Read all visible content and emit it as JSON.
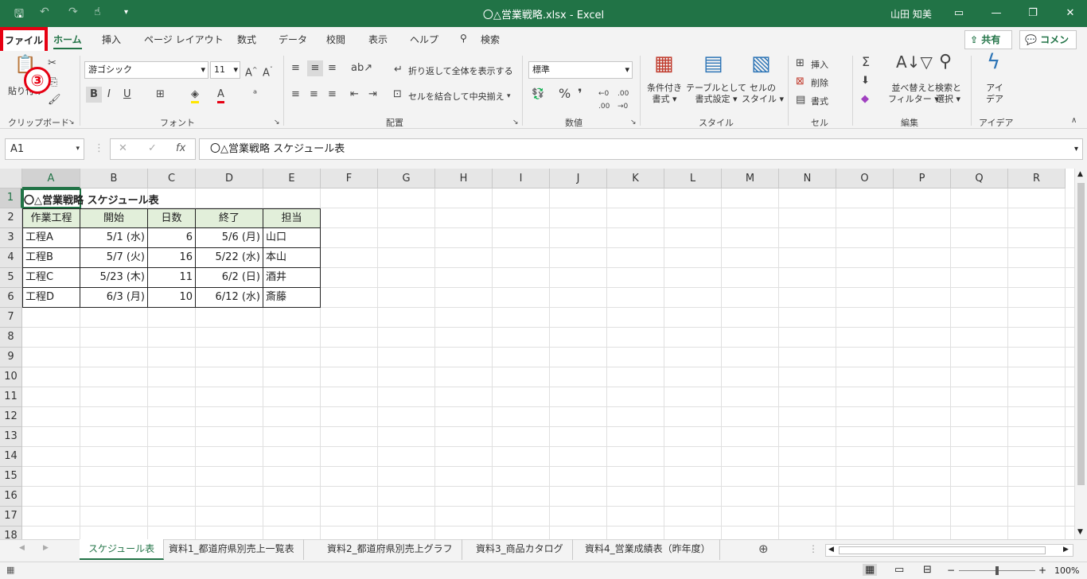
{
  "window": {
    "title": "〇△営業戦略.xlsx  -  Excel",
    "user": "山田 知美"
  },
  "ribbon_tabs": [
    "ファイル",
    "ホーム",
    "挿入",
    "ページ レイアウト",
    "数式",
    "データ",
    "校閲",
    "表示",
    "ヘルプ",
    "検索"
  ],
  "share": "共有",
  "comment": "コメント",
  "step_badge": "③",
  "clipboard": {
    "paste": "貼り付け",
    "group": "クリップボード"
  },
  "font": {
    "name": "游ゴシック",
    "size": "11",
    "bold": "B",
    "italic": "I",
    "underline": "U",
    "group": "フォント"
  },
  "alignment": {
    "wrap": "折り返して全体を表示する",
    "merge": "セルを結合して中央揃え",
    "group": "配置"
  },
  "number": {
    "format": "標準",
    "percent": "%",
    "comma": "❜",
    "group": "数値"
  },
  "styles": {
    "cond": [
      "条件付き",
      "書式"
    ],
    "table": [
      "テーブルとして",
      "書式設定"
    ],
    "cell": [
      "セルの",
      "スタイル"
    ],
    "group": "スタイル"
  },
  "cells": {
    "insert": "挿入",
    "delete": "削除",
    "format": "書式",
    "group": "セル"
  },
  "editing": {
    "sum": "Σ",
    "sort": [
      "並べ替えと",
      "フィルター"
    ],
    "find": [
      "検索と",
      "選択"
    ],
    "group": "編集"
  },
  "ideas": {
    "label": [
      "アイ",
      "デア"
    ],
    "group": "アイデア"
  },
  "name_box": "A1",
  "fx": "fx",
  "formula": "〇△営業戦略 スケジュール表",
  "columns": [
    "A",
    "B",
    "C",
    "D",
    "E",
    "F",
    "G",
    "H",
    "I",
    "J",
    "K",
    "L",
    "M",
    "N",
    "O",
    "P",
    "Q",
    "R"
  ],
  "rows": [
    "1",
    "2",
    "3",
    "4",
    "5",
    "6",
    "7",
    "8",
    "9",
    "10",
    "11",
    "12",
    "13",
    "14",
    "15",
    "16",
    "17",
    "18"
  ],
  "sheet": {
    "title": "〇△営業戦略 スケジュール表",
    "headers": [
      "作業工程",
      "開始",
      "日数",
      "終了",
      "担当"
    ],
    "data": [
      [
        "工程A",
        "5/1 (水)",
        "6",
        "5/6 (月)",
        "山口"
      ],
      [
        "工程B",
        "5/7 (火)",
        "16",
        "5/22 (水)",
        "本山"
      ],
      [
        "工程C",
        "5/23 (木)",
        "11",
        "6/2 (日)",
        "酒井"
      ],
      [
        "工程D",
        "6/3 (月)",
        "10",
        "6/12 (水)",
        "斎藤"
      ]
    ]
  },
  "sheet_tabs": [
    "スケジュール表",
    "資料1_都道府県別売上一覧表",
    "資料2_都道府県別売上グラフ",
    "資料3_商品カタログ",
    "資料4_営業成績表（昨年度）"
  ],
  "zoom": "100%",
  "colors": {
    "accent": "#217346",
    "highlight": "#e60012",
    "header_fill": "#e2efda"
  }
}
